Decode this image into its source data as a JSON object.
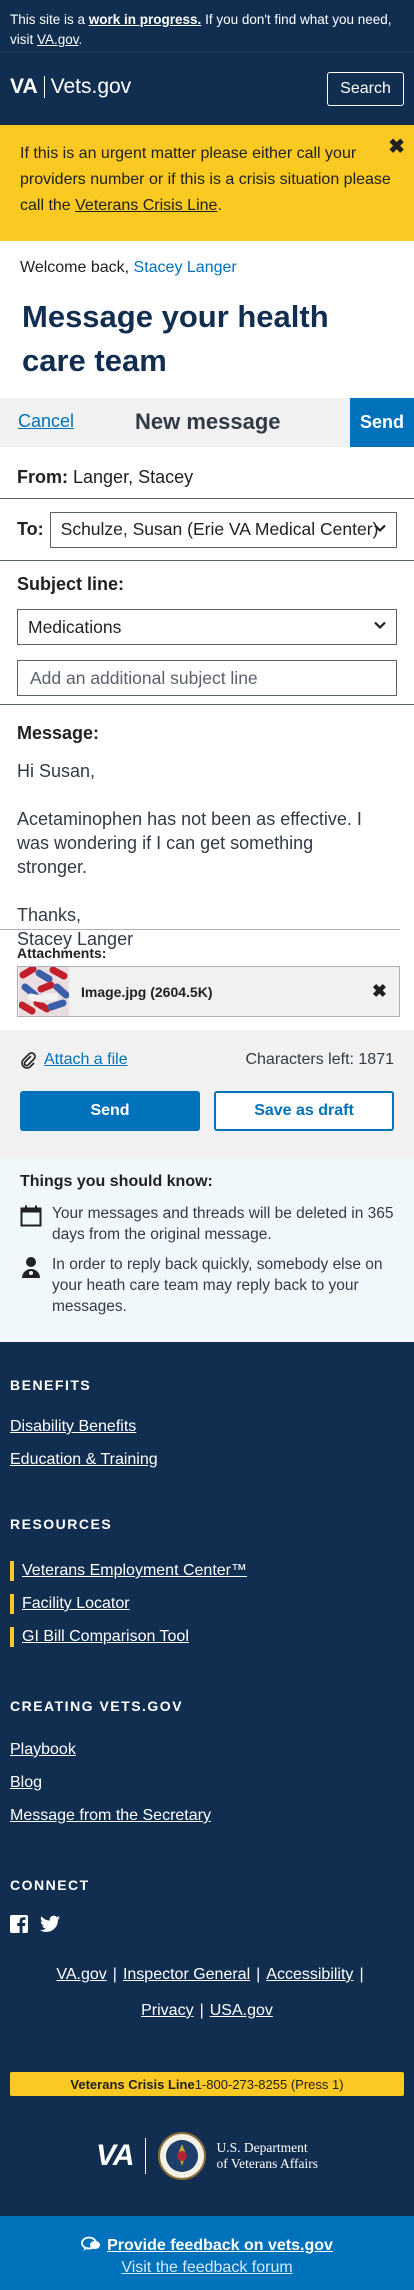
{
  "banner": {
    "lead": "This site is a ",
    "wip": "work in progress.",
    "rest": " If you don't find what you need, visit ",
    "link": "VA.gov",
    "end": "."
  },
  "header": {
    "va": "VA",
    "site": "Vets.gov",
    "search": "Search"
  },
  "alert": {
    "text": "If this is an urgent matter please either call your providers number or if this is a crisis situation please call  the ",
    "link": "Veterans Crisis Line",
    "end": ".",
    "close": "✖"
  },
  "welcome": {
    "text": "Welcome back, ",
    "name": "Stacey Langer"
  },
  "page_title": "Message your health care team",
  "compose_bar": {
    "cancel": "Cancel",
    "title": "New message",
    "send": "Send"
  },
  "from": {
    "label": "From:",
    "value": "Langer, Stacey"
  },
  "to": {
    "label": "To:",
    "value": "Schulze, Susan (Erie VA Medical Center)"
  },
  "subject": {
    "label": "Subject line:",
    "value": "Medications",
    "placeholder": "Add an additional subject line"
  },
  "message": {
    "label": "Message:",
    "greeting": "Hi Susan,",
    "body": "Acetaminophen has not been as effective. I was wondering if I can get something stronger.",
    "closing": "Thanks,",
    "signature": "Stacey Langer"
  },
  "attachments": {
    "label": "Attachments:",
    "files": [
      {
        "name": "Image.jpg (2604.5K)"
      }
    ]
  },
  "actions": {
    "attach": "Attach a file",
    "chars_left": "Characters left: 1871",
    "send": "Send",
    "draft": "Save as draft"
  },
  "know": {
    "title": "Things you should know:",
    "items": [
      "Your messages and threads will be deleted in 365 days from the original message.",
      "In order to reply back quickly, somebody else on your heath care team may reply back to your messages."
    ]
  },
  "footer": {
    "benefits": {
      "heading": "BENEFITS",
      "links": [
        "Disability Benefits",
        "Education & Training"
      ]
    },
    "resources": {
      "heading": "RESOURCES",
      "links": [
        "Veterans Employment Center™",
        "Facility Locator",
        "GI Bill Comparison Tool"
      ]
    },
    "creating": {
      "heading": "CREATING VETS.GOV",
      "links": [
        "Playbook",
        "Blog",
        "Message from the Secretary"
      ]
    },
    "connect": {
      "heading": "CONNECT"
    },
    "bottom_links": [
      "VA.gov",
      "Inspector General",
      "Accessibility",
      "Privacy",
      "USA.gov"
    ],
    "crisis": {
      "bold": "Veterans Crisis Line",
      "phone": " 1-800-273-8255 (Press 1)"
    },
    "dept": {
      "va": "VA",
      "line1": "U.S. Department",
      "line2": "of Veterans Affairs"
    },
    "feedback": {
      "primary": "Provide feedback on vets.gov",
      "secondary": "Visit the feedback forum"
    }
  }
}
